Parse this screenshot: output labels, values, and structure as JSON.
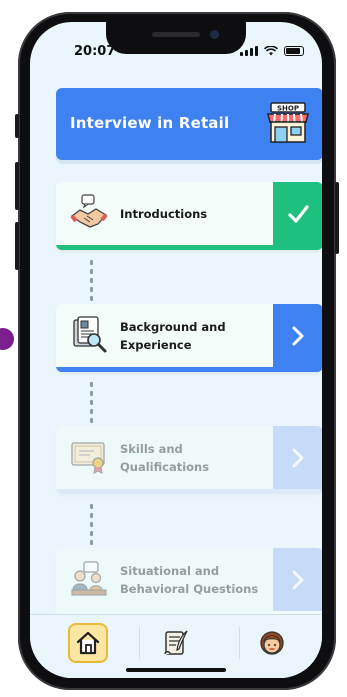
{
  "status_bar": {
    "time": "20:07"
  },
  "header": {
    "title": "Interview in Retail",
    "icon": "shop-icon",
    "shop_sign": "SHOP"
  },
  "steps": [
    {
      "label": "Introductions",
      "status": "completed",
      "icon": "handshake-icon",
      "action_icon": "checkmark-icon"
    },
    {
      "label": "Background and Experience",
      "status": "active",
      "icon": "document-search-icon",
      "action_icon": "chevron-right-icon"
    },
    {
      "label": "Skills and Qualifications",
      "status": "locked",
      "icon": "certificate-icon",
      "action_icon": "chevron-right-icon"
    },
    {
      "label": "Situational and Behavioral Questions",
      "status": "locked",
      "icon": "meeting-icon",
      "action_icon": "chevron-right-icon"
    }
  ],
  "tabbar": {
    "items": [
      {
        "name": "home",
        "icon": "home-icon",
        "selected": true
      },
      {
        "name": "journal",
        "icon": "scroll-quill-icon",
        "selected": false
      },
      {
        "name": "profile",
        "icon": "avatar-icon",
        "selected": false
      }
    ]
  },
  "colors": {
    "primary": "#3d82f0",
    "success": "#1fbf7d",
    "background": "#eaf6fb",
    "tab_selected": "#fde7a3"
  }
}
